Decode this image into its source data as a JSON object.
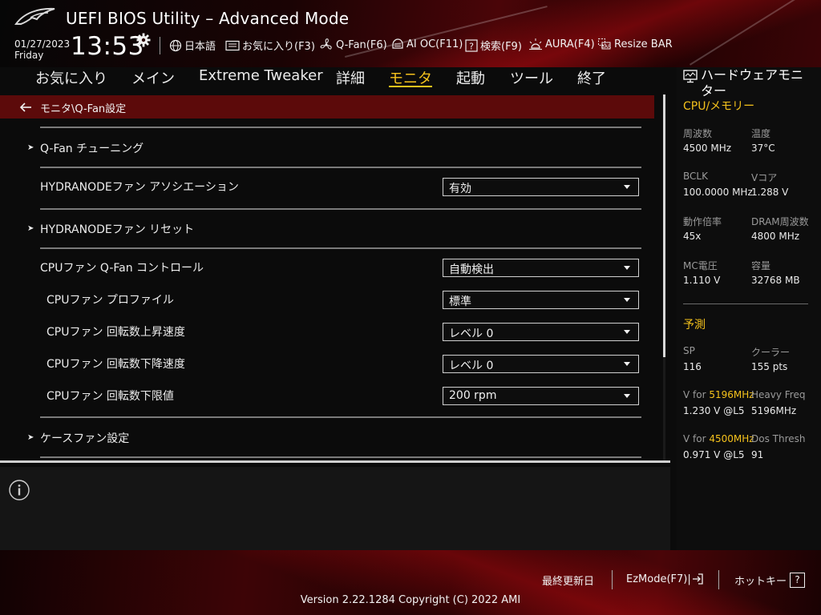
{
  "header": {
    "title": "UEFI BIOS Utility – Advanced Mode",
    "date": "01/27/2023",
    "day": "Friday",
    "time": "13:53"
  },
  "toolbar": {
    "language": "日本語",
    "favorites": "お気に入り(F3)",
    "qfan": "Q-Fan(F6)",
    "ai_oc": "AI OC(F11)",
    "search": "検索(F9)",
    "aura": "AURA(F4)",
    "resize_bar": "Resize BAR"
  },
  "nav": {
    "tabs": [
      "お気に入り",
      "メイン",
      "Extreme Tweaker",
      "詳細",
      "モニタ",
      "起動",
      "ツール",
      "終了"
    ],
    "active": "モニタ"
  },
  "breadcrumb": "モニタ\\Q-Fan設定",
  "settings": {
    "qfan_tuning": "Q-Fan チューニング",
    "hydranode_assoc": {
      "label": "HYDRANODEファン アソシエーション",
      "value": "有効"
    },
    "hydranode_reset": "HYDRANODEファン リセット",
    "cpu_fan_control": {
      "label": "CPUファン Q-Fan コントロール",
      "value": "自動検出"
    },
    "cpu_fan_profile": {
      "label": "CPUファン プロファイル",
      "value": "標準"
    },
    "cpu_fan_step_up": {
      "label": "CPUファン 回転数上昇速度",
      "value": "レベル 0"
    },
    "cpu_fan_step_down": {
      "label": "CPUファン 回転数下降速度",
      "value": "レベル 0"
    },
    "cpu_fan_min": {
      "label": "CPUファン 回転数下限値",
      "value": "200 rpm"
    },
    "case_fan": "ケースファン設定"
  },
  "hw_monitor": {
    "title": "ハードウェアモニター",
    "cpu_mem_header": "CPU/メモリー",
    "freq_label": "周波数",
    "freq": "4500 MHz",
    "temp_label": "温度",
    "temp": "37°C",
    "bclk_label": "BCLK",
    "bclk": "100.0000 MHz",
    "vcore_label": "Vコア",
    "vcore": "1.288 V",
    "ratio_label": "動作倍率",
    "ratio": "45x",
    "dram_freq_label": "DRAM周波数",
    "dram_freq": "4800 MHz",
    "mc_volt_label": "MC電圧",
    "mc_volt": "1.110 V",
    "capacity_label": "容量",
    "capacity": "32768 MB",
    "prediction_header": "予測",
    "sp_label": "SP",
    "sp": "116",
    "cooler_label": "クーラー",
    "cooler": "155 pts",
    "v_for_1_prefix": "V for ",
    "v_for_1_freq": "5196MHz",
    "v_for_1": "1.230 V @L5",
    "heavy_freq_label": "Heavy Freq",
    "heavy_freq": "5196MHz",
    "v_for_2_prefix": "V for ",
    "v_for_2_freq": "4500MHz",
    "v_for_2": "0.971 V @L5",
    "dos_thresh_label": "Dos Thresh",
    "dos_thresh": "91"
  },
  "footer": {
    "last_modified": "最終更新日",
    "ezmode": "EzMode(F7)|",
    "hotkeys": "ホットキー",
    "hotkey_glyph": "?",
    "version": "Version 2.22.1284 Copyright (C) 2022 AMI"
  },
  "colors": {
    "accent": "#f5c21c",
    "crumb_bg": "#5c0a0a",
    "brand_red": "#4a0508"
  }
}
